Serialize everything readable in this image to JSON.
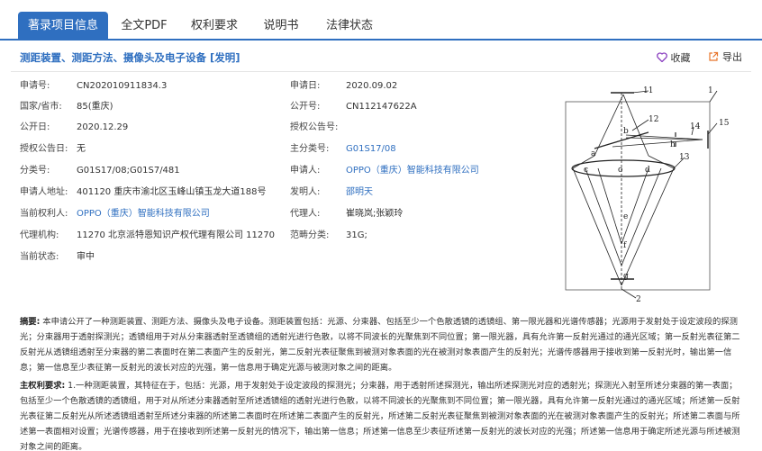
{
  "tabs": [
    {
      "label": "著录项目信息",
      "active": true
    },
    {
      "label": "全文PDF",
      "active": false
    },
    {
      "label": "权利要求",
      "active": false
    },
    {
      "label": "说明书",
      "active": false
    },
    {
      "label": "法律状态",
      "active": false
    }
  ],
  "title": "测距装置、测距方法、摄像头及电子设备 [发明]",
  "actions": {
    "favorite": "收藏",
    "export": "导出"
  },
  "fields_left": [
    {
      "label": "申请号:",
      "value": "CN202010911834.3"
    },
    {
      "label": "国家/省市:",
      "value": "85(重庆)"
    },
    {
      "label": "公开日:",
      "value": "2020.12.29"
    },
    {
      "label": "授权公告日:",
      "value": "无"
    },
    {
      "label": "分类号:",
      "value": "G01S17/08;G01S7/481"
    },
    {
      "label": "申请人地址:",
      "value": "401120 重庆市渝北区玉峰山镇玉龙大道188号"
    },
    {
      "label": "当前权利人:",
      "value": "OPPO（重庆）智能科技有限公司",
      "link": true
    },
    {
      "label": "代理机构:",
      "value": "11270 北京派特恩知识产权代理有限公司 11270"
    },
    {
      "label": "当前状态:",
      "value": "审中"
    }
  ],
  "fields_right": [
    {
      "label": "申请日:",
      "value": "2020.09.02"
    },
    {
      "label": "公开号:",
      "value": "CN112147622A"
    },
    {
      "label": "授权公告号:",
      "value": ""
    },
    {
      "label": "主分类号:",
      "value": "G01S17/08",
      "link": true
    },
    {
      "label": "申请人:",
      "value": "OPPO（重庆）智能科技有限公司",
      "link": true
    },
    {
      "label": "发明人:",
      "value": "邵明天",
      "link": true
    },
    {
      "label": "代理人:",
      "value": "崔晓岚;张颖玲"
    },
    {
      "label": "范畴分类:",
      "value": "31G;"
    }
  ],
  "figure_labels": [
    "1",
    "11",
    "12",
    "13",
    "14",
    "15",
    "2",
    "a",
    "b",
    "c",
    "d",
    "e",
    "f",
    "g",
    "h",
    "o"
  ],
  "abstract": {
    "label": "摘要:",
    "text": " 本申请公开了一种测距装置、测距方法、摄像头及电子设备。测距装置包括：光源、分束器、包括至少一个色散透镜的透镜组、第一限光器和光谱传感器；光源用于发射处于设定波段的探测光；分束器用于透射探测光；透镜组用于对从分束器透射至透镜组的透射光进行色散，以将不同波长的光聚焦到不同位置；第一限光器，具有允许第一反射光通过的通光区域；第一反射光表征第二反射光从透镜组透射至分束器的第二表面时在第二表面产生的反射光，第二反射光表征聚焦到被测对象表面的光在被测对象表面产生的反射光；光谱传感器用于接收到第一反射光时，输出第一信息；第一信息至少表征第一反射光的波长对应的光强，第一信息用于确定光源与被测对象之间的距离。"
  },
  "claims": {
    "label": "主权利要求:",
    "text": " 1.一种测距装置，其特征在于，包括：光源，用于发射处于设定波段的探测光；分束器，用于透射所述探测光，输出所述探测光对应的透射光；探测光入射至所述分束器的第一表面；包括至少一个色散透镜的透镜组，用于对从所述分束器透射至所述透镜组的透射光进行色散，以将不同波长的光聚焦到不同位置；第一限光器，具有允许第一反射光通过的通光区域；所述第一反射光表征第二反射光从所述透镜组透射至所述分束器的所述第二表面时在所述第二表面产生的反射光，所述第二反射光表征聚焦到被测对象表面的光在被测对象表面产生的反射光；所述第二表面与所述第一表面相对设置；光谱传感器，用于在接收到所述第一反射光的情况下，输出第一信息；所述第一信息至少表征所述第一反射光的波长对应的光强；所述第一信息用于确定所述光源与所述被测对象之间的距离。"
  }
}
